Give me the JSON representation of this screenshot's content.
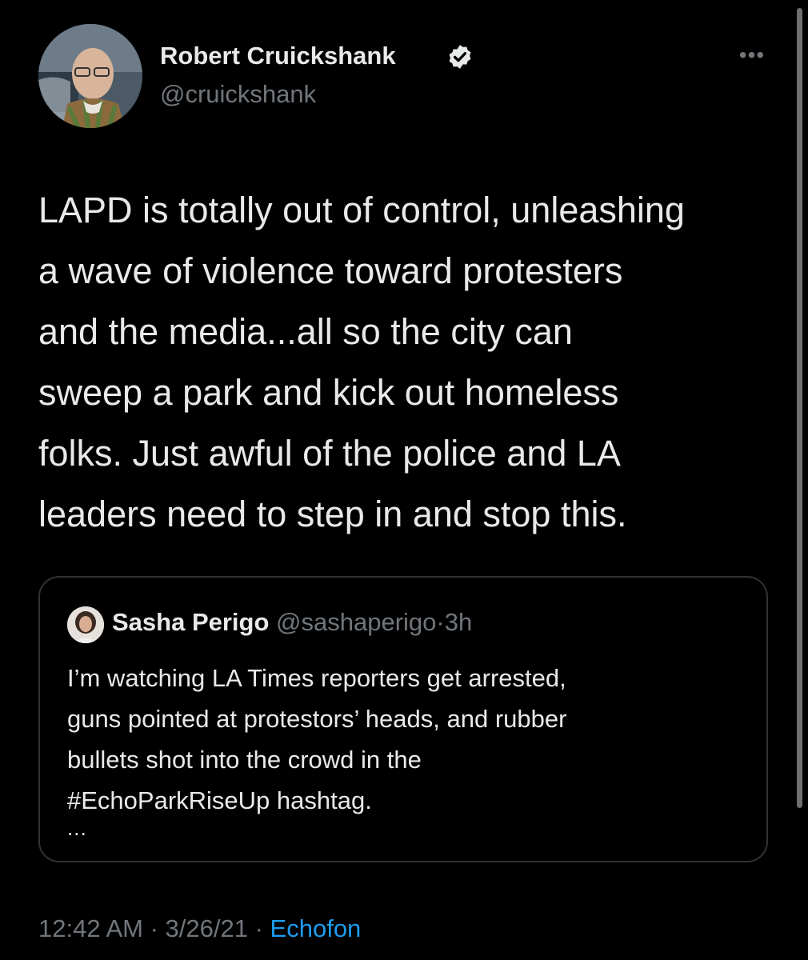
{
  "author": {
    "name": "Robert Cruickshank",
    "handle": "@cruickshank",
    "verified": true,
    "avatar_icon": "profile-photo"
  },
  "more_menu": {
    "icon": "more-horizontal-icon",
    "glyph": "•••"
  },
  "tweet": {
    "text_lines": [
      "LAPD is totally out of control, unleashing",
      "a wave of violence toward protesters",
      "and the media...all so the city can",
      "sweep a park and kick out homeless",
      "folks. Just awful of the police and LA",
      "leaders need to step in and stop this."
    ]
  },
  "quote": {
    "name": "Sasha Perigo",
    "handle": "@sashaperigo",
    "separator": "·",
    "time": "3h",
    "text_lines": [
      "I’m watching LA Times reporters get arrested,",
      "guns pointed at protestors’ heads, and rubber",
      "bullets shot into the crowd in the",
      "#EchoParkRiseUp hashtag."
    ],
    "ellipsis": "..."
  },
  "meta": {
    "time": "12:42 AM",
    "sep1": " · ",
    "date": "3/26/21",
    "sep2": " · ",
    "source": "Echofon"
  },
  "colors": {
    "background": "#000000",
    "text_primary": "#e7e9ea",
    "text_secondary": "#71767b",
    "link": "#1d9bf0",
    "border": "#2f3336"
  }
}
